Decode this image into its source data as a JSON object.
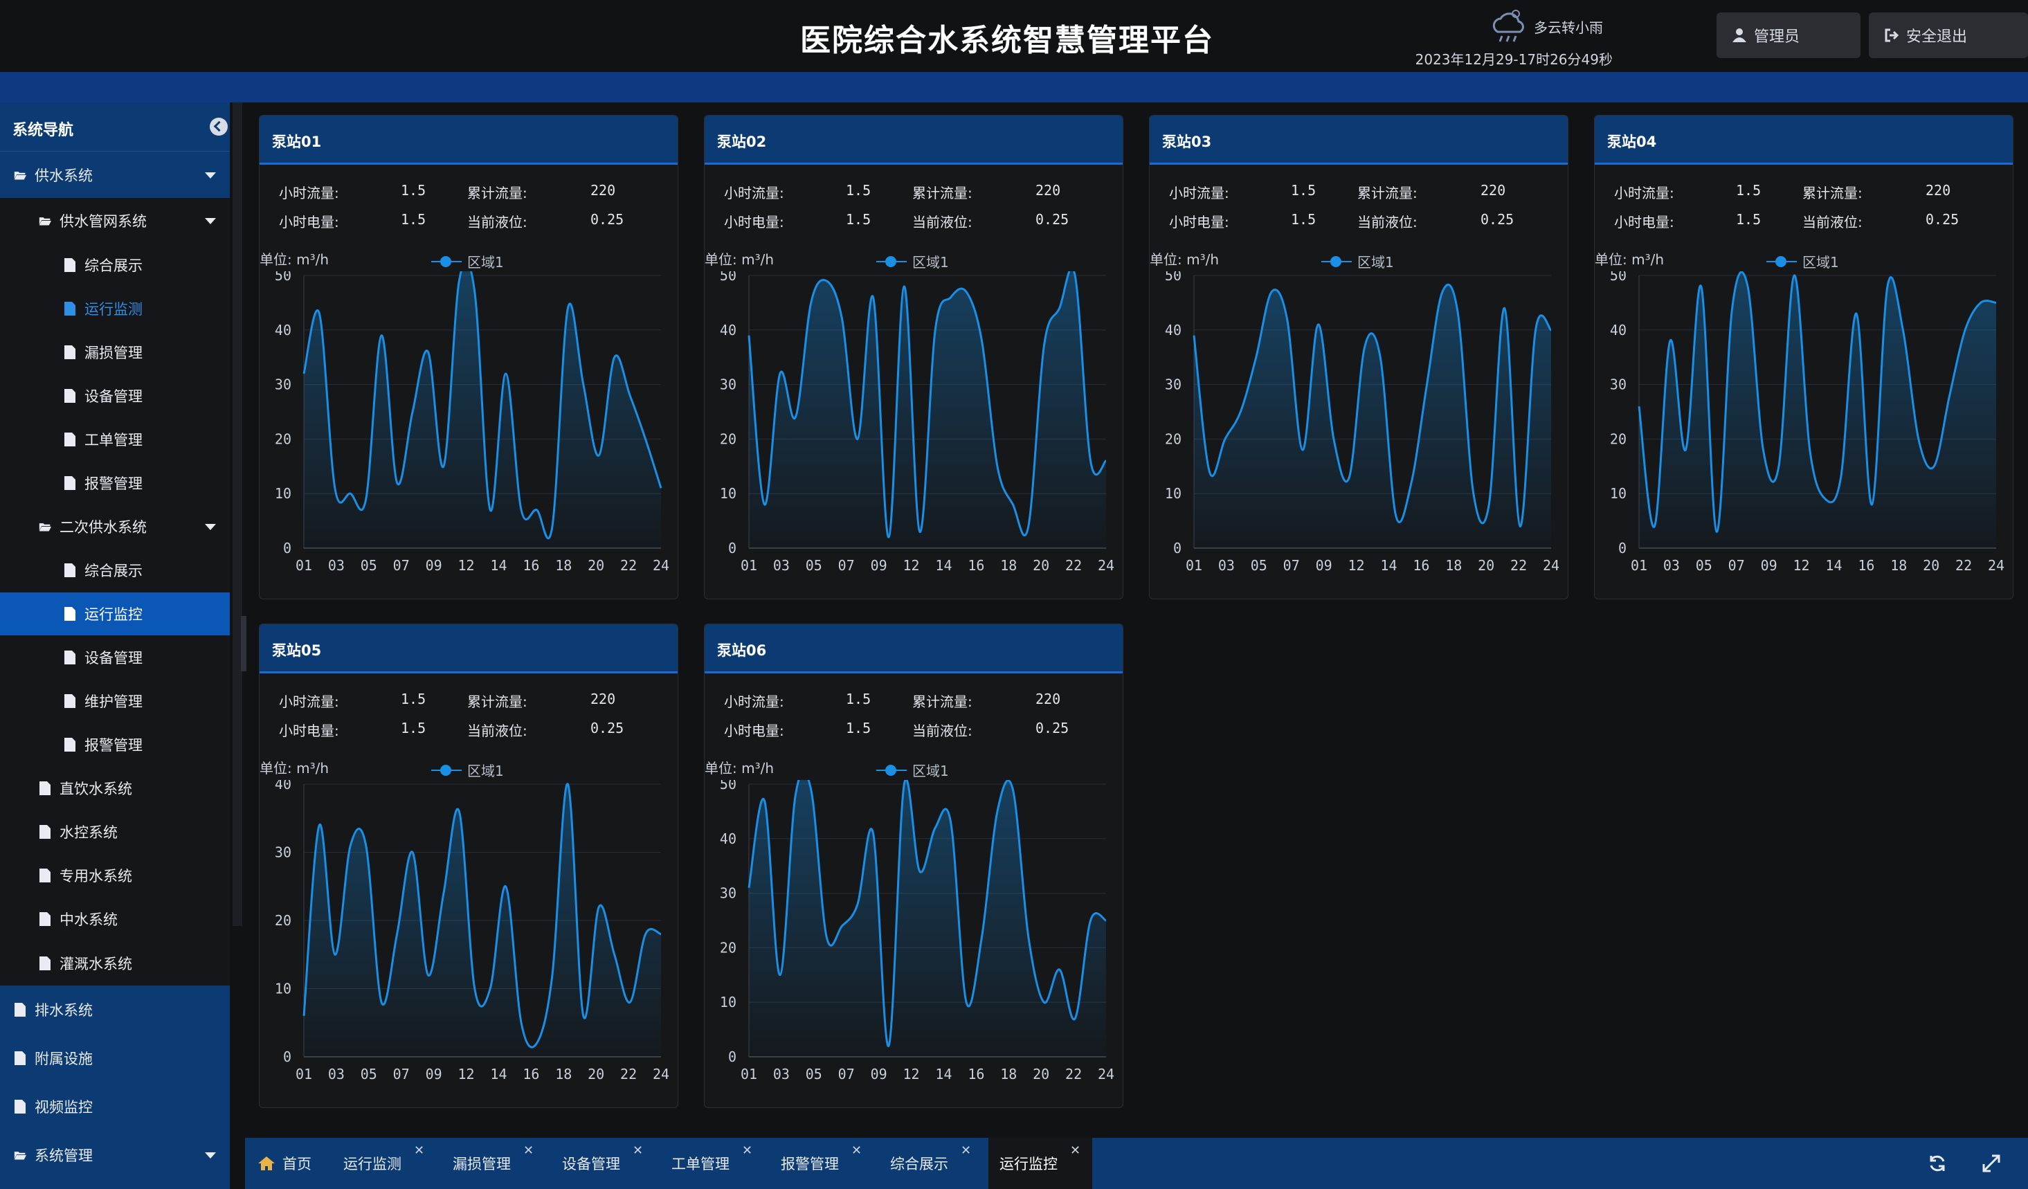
{
  "header": {
    "title": "医院综合水系统智慧管理平台",
    "weather": "多云转小雨",
    "weather_icon": "cloud-rain-icon",
    "datetime": "2023年12月29-17时26分49秒",
    "user_label": "管理员",
    "logout_label": "安全退出"
  },
  "sidebar": {
    "title": "系统导航",
    "items": [
      {
        "label": "供水系统"
      },
      {
        "label": "供水管网系统"
      },
      {
        "label": "综合展示"
      },
      {
        "label": "运行监测"
      },
      {
        "label": "漏损管理"
      },
      {
        "label": "设备管理"
      },
      {
        "label": "工单管理"
      },
      {
        "label": "报警管理"
      },
      {
        "label": "二次供水系统"
      },
      {
        "label": "综合展示"
      },
      {
        "label": "运行监控"
      },
      {
        "label": "设备管理"
      },
      {
        "label": "维护管理"
      },
      {
        "label": "报警管理"
      },
      {
        "label": "直饮水系统"
      },
      {
        "label": "水控系统"
      },
      {
        "label": "专用水系统"
      },
      {
        "label": "中水系统"
      },
      {
        "label": "灌溉水系统"
      },
      {
        "label": "排水系统"
      },
      {
        "label": "附属设施"
      },
      {
        "label": "视频监控"
      },
      {
        "label": "系统管理"
      }
    ]
  },
  "labels": {
    "hourly_flow": "小时流量:",
    "cumulative_flow": "累计流量:",
    "hourly_power": "小时电量:",
    "current_level": "当前液位:",
    "unit": "单位: m³/h",
    "legend": "区域1"
  },
  "stations": [
    {
      "name": "泵站01",
      "hourly_flow": "1.5",
      "cumulative_flow": "220",
      "hourly_power": "1.5",
      "current_level": "0.25"
    },
    {
      "name": "泵站02",
      "hourly_flow": "1.5",
      "cumulative_flow": "220",
      "hourly_power": "1.5",
      "current_level": "0.25"
    },
    {
      "name": "泵站03",
      "hourly_flow": "1.5",
      "cumulative_flow": "220",
      "hourly_power": "1.5",
      "current_level": "0.25"
    },
    {
      "name": "泵站04",
      "hourly_flow": "1.5",
      "cumulative_flow": "220",
      "hourly_power": "1.5",
      "current_level": "0.25"
    },
    {
      "name": "泵站05",
      "hourly_flow": "1.5",
      "cumulative_flow": "220",
      "hourly_power": "1.5",
      "current_level": "0.25"
    },
    {
      "name": "泵站06",
      "hourly_flow": "1.5",
      "cumulative_flow": "220",
      "hourly_power": "1.5",
      "current_level": "0.25"
    }
  ],
  "tabs": [
    {
      "label": "首页"
    },
    {
      "label": "运行监测"
    },
    {
      "label": "漏损管理"
    },
    {
      "label": "设备管理"
    },
    {
      "label": "工单管理"
    },
    {
      "label": "报警管理"
    },
    {
      "label": "综合展示"
    },
    {
      "label": "运行监控"
    }
  ],
  "colors": {
    "accent": "#1a8fe6",
    "header_blue": "#0c3a73",
    "active": "#0b57b5"
  },
  "chart_data": [
    {
      "type": "area",
      "title": "泵站01",
      "ylabel": "单位: m³/h",
      "series_name": "区域1",
      "x": [
        "01",
        "02",
        "03",
        "04",
        "05",
        "06",
        "07",
        "08",
        "09",
        "10",
        "11",
        "12",
        "13",
        "14",
        "15",
        "16",
        "17",
        "18",
        "19",
        "20",
        "21",
        "22",
        "23",
        "24"
      ],
      "xticks": [
        "01",
        "03",
        "05",
        "07",
        "09",
        "12",
        "14",
        "16",
        "18",
        "20",
        "22",
        "24"
      ],
      "ylim": [
        0,
        50
      ],
      "yticks": [
        0,
        10,
        20,
        30,
        40,
        50
      ],
      "values": [
        32,
        43,
        11,
        10,
        9,
        39,
        12,
        25,
        36,
        15,
        49,
        47,
        7,
        32,
        7,
        7,
        4,
        44,
        30,
        17,
        35,
        28,
        20,
        11
      ]
    },
    {
      "type": "area",
      "title": "泵站02",
      "ylabel": "单位: m³/h",
      "series_name": "区域1",
      "x": [
        "01",
        "02",
        "03",
        "04",
        "05",
        "06",
        "07",
        "08",
        "09",
        "10",
        "11",
        "12",
        "13",
        "14",
        "15",
        "16",
        "17",
        "18",
        "19",
        "20",
        "21",
        "22",
        "23",
        "24"
      ],
      "xticks": [
        "01",
        "03",
        "05",
        "07",
        "09",
        "12",
        "14",
        "16",
        "18",
        "20",
        "22",
        "24"
      ],
      "ylim": [
        0,
        50
      ],
      "yticks": [
        0,
        10,
        20,
        30,
        40,
        50
      ],
      "values": [
        39,
        8,
        32,
        24,
        45,
        49,
        42,
        20,
        46,
        2,
        48,
        3,
        40,
        46,
        47,
        38,
        15,
        8,
        4,
        37,
        44,
        50,
        16,
        16
      ]
    },
    {
      "type": "area",
      "title": "泵站03",
      "ylabel": "单位: m³/h",
      "series_name": "区域1",
      "x": [
        "01",
        "02",
        "03",
        "04",
        "05",
        "06",
        "07",
        "08",
        "09",
        "10",
        "11",
        "12",
        "13",
        "14",
        "15",
        "16",
        "17",
        "18",
        "19",
        "20",
        "21",
        "22",
        "23",
        "24"
      ],
      "xticks": [
        "01",
        "03",
        "05",
        "07",
        "09",
        "12",
        "14",
        "16",
        "18",
        "20",
        "22",
        "24"
      ],
      "ylim": [
        0,
        50
      ],
      "yticks": [
        0,
        10,
        20,
        30,
        40,
        50
      ],
      "values": [
        39,
        14,
        20,
        25,
        35,
        47,
        42,
        18,
        41,
        20,
        13,
        37,
        35,
        6,
        12,
        30,
        47,
        43,
        10,
        8,
        44,
        4,
        40,
        40
      ]
    },
    {
      "type": "area",
      "title": "泵站04",
      "ylabel": "单位: m³/h",
      "series_name": "区域1",
      "x": [
        "01",
        "02",
        "03",
        "04",
        "05",
        "06",
        "07",
        "08",
        "09",
        "10",
        "11",
        "12",
        "13",
        "14",
        "15",
        "16",
        "17",
        "18",
        "19",
        "20",
        "21",
        "22",
        "23",
        "24"
      ],
      "xticks": [
        "01",
        "03",
        "05",
        "07",
        "09",
        "12",
        "14",
        "16",
        "18",
        "20",
        "22",
        "24"
      ],
      "ylim": [
        0,
        50
      ],
      "yticks": [
        0,
        10,
        20,
        30,
        40,
        50
      ],
      "values": [
        26,
        4,
        38,
        18,
        48,
        3,
        44,
        48,
        18,
        15,
        50,
        18,
        9,
        13,
        43,
        8,
        48,
        40,
        20,
        15,
        28,
        40,
        45,
        45
      ]
    },
    {
      "type": "area",
      "title": "泵站05",
      "ylabel": "单位: m³/h",
      "series_name": "区域1",
      "x": [
        "01",
        "02",
        "03",
        "04",
        "05",
        "06",
        "07",
        "08",
        "09",
        "10",
        "11",
        "12",
        "13",
        "14",
        "15",
        "16",
        "17",
        "18",
        "19",
        "20",
        "21",
        "22",
        "23",
        "24"
      ],
      "xticks": [
        "01",
        "03",
        "05",
        "07",
        "09",
        "12",
        "14",
        "16",
        "18",
        "20",
        "22",
        "24"
      ],
      "ylim": [
        0,
        40
      ],
      "yticks": [
        0,
        10,
        20,
        30,
        40
      ],
      "values": [
        6,
        34,
        15,
        31,
        31,
        8,
        18,
        30,
        12,
        24,
        36,
        10,
        10,
        25,
        5,
        2,
        12,
        40,
        6,
        22,
        15,
        8,
        18,
        18
      ]
    },
    {
      "type": "area",
      "title": "泵站06",
      "ylabel": "单位: m³/h",
      "series_name": "区域1",
      "x": [
        "01",
        "02",
        "03",
        "04",
        "05",
        "06",
        "07",
        "08",
        "09",
        "10",
        "11",
        "12",
        "13",
        "14",
        "15",
        "16",
        "17",
        "18",
        "19",
        "20",
        "21",
        "22",
        "23",
        "24"
      ],
      "xticks": [
        "01",
        "03",
        "05",
        "07",
        "09",
        "12",
        "14",
        "16",
        "18",
        "20",
        "22",
        "24"
      ],
      "ylim": [
        0,
        50
      ],
      "yticks": [
        0,
        10,
        20,
        30,
        40,
        50
      ],
      "values": [
        31,
        47,
        15,
        48,
        49,
        22,
        24,
        28,
        41,
        2,
        50,
        34,
        42,
        43,
        10,
        22,
        45,
        49,
        22,
        10,
        16,
        7,
        25,
        25
      ]
    }
  ]
}
